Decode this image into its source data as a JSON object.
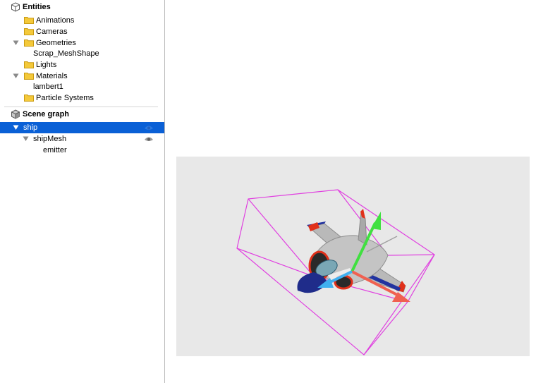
{
  "sidebar": {
    "entities_header": "Entities",
    "entities": [
      {
        "label": "Animations",
        "icon": "folder-icon"
      },
      {
        "label": "Cameras",
        "icon": "folder-icon"
      },
      {
        "label": "Geometries",
        "icon": "folder-icon",
        "expanded": true
      },
      {
        "label": "Scrap_MeshShape"
      },
      {
        "label": "Lights",
        "icon": "folder-icon"
      },
      {
        "label": "Materials",
        "icon": "folder-icon",
        "expanded": true
      },
      {
        "label": "lambert1"
      },
      {
        "label": "Particle Systems",
        "icon": "folder-icon"
      }
    ],
    "scene_graph_header": "Scene graph",
    "scene_graph": [
      {
        "label": "ship",
        "selected": true,
        "expanded": true,
        "visibility_icon": "eye-icon"
      },
      {
        "label": "shipMesh",
        "expanded": true,
        "visibility_icon": "eye-icon"
      },
      {
        "label": "emitter"
      }
    ]
  },
  "viewport": {
    "content": "3D scene with jet model, bounding box and transform gizmo",
    "colors": {
      "background": "#e8e8e8",
      "bounding_box": "#e040e0",
      "gizmo_x": "#f06050",
      "gizmo_y": "#40e040",
      "gizmo_z": "#40b0f0",
      "selection": "#0a60d6"
    }
  }
}
